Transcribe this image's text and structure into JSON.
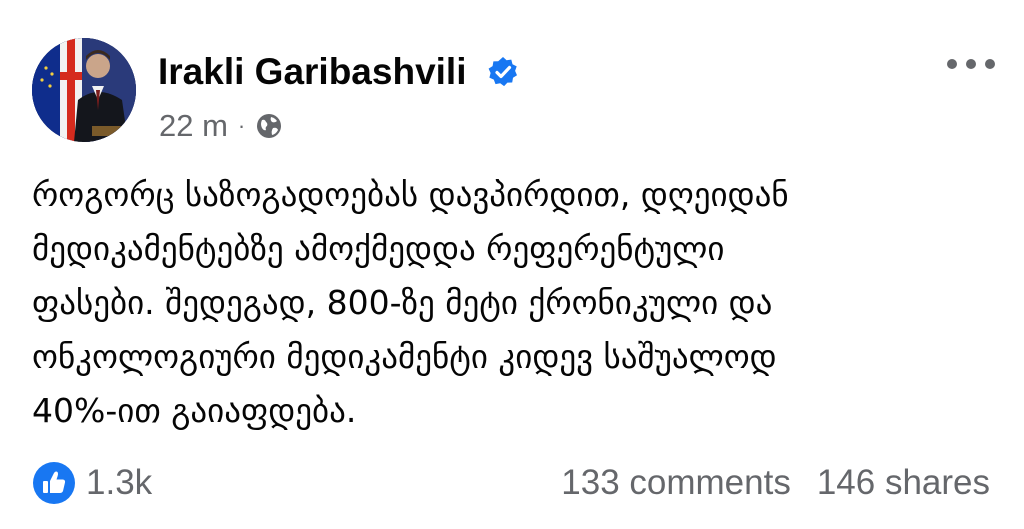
{
  "post": {
    "author": "Irakli Garibashvili",
    "time": "22 m",
    "separator": "·",
    "audience_icon": "globe-icon",
    "verified_icon": "verified-badge-icon",
    "menu_icon": "more-options-icon",
    "text_lines": [
      "როგორც საზოგადოებას დავპირდით, დღეიდან",
      "მედიკამენტებზე ამოქმედდა რეფერენტული",
      "ფასები. შედეგად, 800-ზე მეტი ქრონიკული და",
      "ონკოლოგიური მედიკამენტი კიდევ საშუალოდ",
      "40%-ით გაიაფდება."
    ]
  },
  "footer": {
    "reactions_icon": "like-icon",
    "reactions_count": "1.3k",
    "comments": "133 comments",
    "shares": "146 shares"
  },
  "colors": {
    "text": "#050505",
    "secondary": "#65676b",
    "accent": "#1877f2"
  }
}
